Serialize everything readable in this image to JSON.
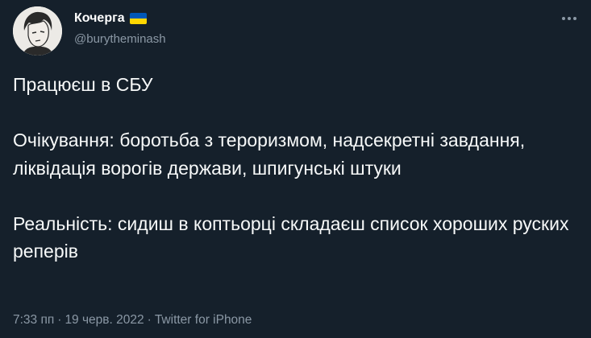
{
  "author": {
    "display_name": "Кочерга",
    "handle": "@burytheminash",
    "flag": "ukraine-flag-icon"
  },
  "tweet": {
    "text": "Працюєш в СБУ\n\nОчікування: боротьба з тероризмом, надсекретні завдання, ліквідація ворогів держави, шпигунські штуки\n\nРеальність: сидиш в коптьорці складаєш список хороших руских реперів"
  },
  "meta": {
    "time": "7:33 пп",
    "separator": "·",
    "date": "19 черв. 2022",
    "source": "Twitter for iPhone"
  },
  "colors": {
    "background": "#15202b",
    "text": "#f7f9f9",
    "secondary": "#8b98a5",
    "flag_blue": "#0057b7",
    "flag_yellow": "#ffd700"
  },
  "icons": {
    "more": "more-horizontal-icon",
    "avatar": "avatar-illustration"
  }
}
